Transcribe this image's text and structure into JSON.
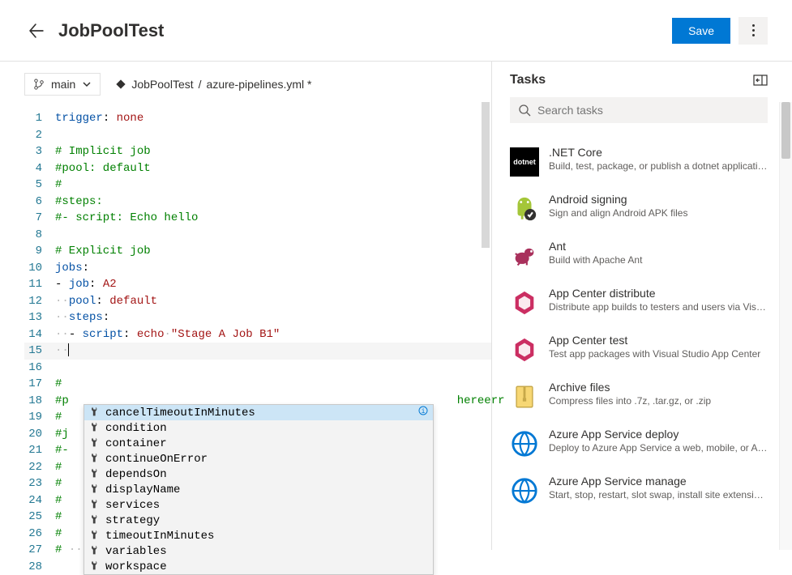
{
  "header": {
    "title": "JobPoolTest",
    "save_label": "Save"
  },
  "branch": {
    "name": "main"
  },
  "breadcrumb": {
    "repo": "JobPoolTest",
    "file": "azure-pipelines.yml *"
  },
  "editor": {
    "lines": [
      {
        "num": 1,
        "segs": [
          {
            "t": "trigger",
            "c": "key"
          },
          {
            "t": ": ",
            "c": "txt"
          },
          {
            "t": "none",
            "c": "str"
          }
        ]
      },
      {
        "num": 2,
        "segs": []
      },
      {
        "num": 3,
        "segs": [
          {
            "t": "# Implicit job",
            "c": "com"
          }
        ]
      },
      {
        "num": 4,
        "segs": [
          {
            "t": "#pool: default",
            "c": "com"
          }
        ]
      },
      {
        "num": 5,
        "segs": [
          {
            "t": "#",
            "c": "com"
          }
        ]
      },
      {
        "num": 6,
        "segs": [
          {
            "t": "#steps:",
            "c": "com"
          }
        ]
      },
      {
        "num": 7,
        "segs": [
          {
            "t": "#- script: Echo hello",
            "c": "com"
          }
        ]
      },
      {
        "num": 8,
        "segs": []
      },
      {
        "num": 9,
        "segs": [
          {
            "t": "# Explicit job",
            "c": "com"
          }
        ]
      },
      {
        "num": 10,
        "segs": [
          {
            "t": "jobs",
            "c": "key"
          },
          {
            "t": ":",
            "c": "txt"
          }
        ]
      },
      {
        "num": 11,
        "segs": [
          {
            "t": "- ",
            "c": "txt"
          },
          {
            "t": "job",
            "c": "key"
          },
          {
            "t": ": ",
            "c": "txt"
          },
          {
            "t": "A2",
            "c": "str"
          }
        ]
      },
      {
        "num": 12,
        "segs": [
          {
            "t": "··",
            "c": "dot"
          },
          {
            "t": "pool",
            "c": "key"
          },
          {
            "t": ": ",
            "c": "txt"
          },
          {
            "t": "default",
            "c": "str"
          }
        ]
      },
      {
        "num": 13,
        "segs": [
          {
            "t": "··",
            "c": "dot"
          },
          {
            "t": "steps",
            "c": "key"
          },
          {
            "t": ":",
            "c": "txt"
          }
        ]
      },
      {
        "num": 14,
        "segs": [
          {
            "t": "··",
            "c": "dot"
          },
          {
            "t": "- ",
            "c": "txt"
          },
          {
            "t": "script",
            "c": "key"
          },
          {
            "t": ": ",
            "c": "txt"
          },
          {
            "t": "echo",
            "c": "str"
          },
          {
            "t": "·",
            "c": "dot"
          },
          {
            "t": "\"Stage A Job B1\"",
            "c": "str"
          }
        ]
      },
      {
        "num": 15,
        "segs": [
          {
            "t": "··",
            "c": "dot"
          }
        ],
        "cursor": true
      },
      {
        "num": 16,
        "segs": []
      },
      {
        "num": 17,
        "segs": [
          {
            "t": "#",
            "c": "com"
          }
        ]
      },
      {
        "num": 18,
        "segs": [
          {
            "t": "#p",
            "c": "com"
          },
          {
            "t": "                                                         ",
            "c": "txt"
          },
          {
            "t": "hereerr",
            "c": "com"
          }
        ]
      },
      {
        "num": 19,
        "segs": [
          {
            "t": "#",
            "c": "com"
          }
        ]
      },
      {
        "num": 20,
        "segs": [
          {
            "t": "#j",
            "c": "com"
          }
        ]
      },
      {
        "num": 21,
        "segs": [
          {
            "t": "#-",
            "c": "com"
          }
        ]
      },
      {
        "num": 22,
        "segs": [
          {
            "t": "# ",
            "c": "com"
          }
        ]
      },
      {
        "num": 23,
        "segs": [
          {
            "t": "# ",
            "c": "com"
          }
        ]
      },
      {
        "num": 24,
        "segs": [
          {
            "t": "# ",
            "c": "com"
          }
        ]
      },
      {
        "num": 25,
        "segs": [
          {
            "t": "# ",
            "c": "com"
          }
        ]
      },
      {
        "num": 26,
        "segs": [
          {
            "t": "# ",
            "c": "com"
          }
        ]
      },
      {
        "num": 27,
        "segs": [
          {
            "t": "# ",
            "c": "com"
          },
          {
            "t": "··",
            "c": "dot"
          },
          {
            "t": "- script: echo \"Stage A Job B1\"",
            "c": "com"
          }
        ]
      },
      {
        "num": 28,
        "segs": []
      }
    ]
  },
  "autocomplete": {
    "items": [
      {
        "label": "cancelTimeoutInMinutes",
        "selected": true,
        "info": true
      },
      {
        "label": "condition"
      },
      {
        "label": "container"
      },
      {
        "label": "continueOnError"
      },
      {
        "label": "dependsOn"
      },
      {
        "label": "displayName"
      },
      {
        "label": "services"
      },
      {
        "label": "strategy"
      },
      {
        "label": "timeoutInMinutes"
      },
      {
        "label": "variables"
      },
      {
        "label": "workspace"
      }
    ]
  },
  "tasks": {
    "title": "Tasks",
    "search_placeholder": "Search tasks",
    "items": [
      {
        "name": ".NET Core",
        "desc": "Build, test, package, or publish a dotnet applicatio…",
        "icon": "dotnet"
      },
      {
        "name": "Android signing",
        "desc": "Sign and align Android APK files",
        "icon": "android"
      },
      {
        "name": "Ant",
        "desc": "Build with Apache Ant",
        "icon": "ant"
      },
      {
        "name": "App Center distribute",
        "desc": "Distribute app builds to testers and users via Visu…",
        "icon": "appcenter"
      },
      {
        "name": "App Center test",
        "desc": "Test app packages with Visual Studio App Center",
        "icon": "appcenter"
      },
      {
        "name": "Archive files",
        "desc": "Compress files into .7z, .tar.gz, or .zip",
        "icon": "zip"
      },
      {
        "name": "Azure App Service deploy",
        "desc": "Deploy to Azure App Service a web, mobile, or AP…",
        "icon": "azure"
      },
      {
        "name": "Azure App Service manage",
        "desc": "Start, stop, restart, slot swap, install site extension…",
        "icon": "azure"
      }
    ]
  }
}
